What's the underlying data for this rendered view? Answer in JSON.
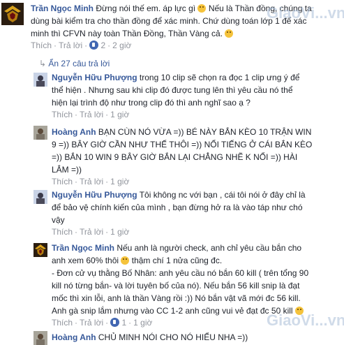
{
  "comment1": {
    "author": "Trần Ngọc Minh",
    "line1": " Đừng nói thế em. áp lực gì ",
    "line1b": " Nếu là Thần đồng, chúng ta",
    "line2": "dùng bài kiểm tra cho thần đồng để xác minh. Chứ dùng toán lớp 1 để xác",
    "line3": "minh thì CFVN này toàn Thần Đồng, Thần Vàng cả. ",
    "like_label": "Thích",
    "reply_label": "Trả lời",
    "like_count": "2",
    "time": "2 giờ"
  },
  "hide_replies": {
    "label": "Ẩn 27 câu trả lời"
  },
  "reply1": {
    "author": "Nguyễn Hữu Phượng",
    "line1": " trong 10 clip sẽ chọn ra đọc 1 clip ưng ý để",
    "line2": "thể hiện . Nhưng sau khi clip đó được tung lên thì yêu cầu nó thể",
    "line3": "hiện lại trình độ như trong clip đó thì anh nghĩ sao ạ ?",
    "like_label": "Thích",
    "reply_label": "Trả lời",
    "time": "1 giờ"
  },
  "reply2": {
    "author": "Hoàng Anh",
    "line1": " BẠN CÙN NÓ VỪA =)) BÉ NÀY BẮN KÈO 10 TRẬN WIN",
    "line2": "9 =)) BÂY GIỜ CẦN NHƯ THẾ THÔI =)) NỔI TIẾNG Ở CÁI BẮN KÈO",
    "line3": "=)) BẮN 10 WIN 9 BÂY GIỜ BẮN LẠI CHẲNG NHẼ K NỔI =)) HÀI",
    "line4": "LẮM =))",
    "like_label": "Thích",
    "reply_label": "Trả lời",
    "time": "1 giờ"
  },
  "reply3": {
    "author": "Nguyễn Hữu Phượng",
    "line1": " Tôi không nc với bạn , cái tôi nói ở đây chỉ là",
    "line2": "để bảo vệ chính kiến của mình , bạn đừng hở ra là vào táp như chó",
    "line3": "vậy",
    "like_label": "Thích",
    "reply_label": "Trả lời",
    "time": "1 giờ"
  },
  "reply4": {
    "author": "Trần Ngọc Minh",
    "line1": " Nếu anh là người check, anh chỉ yêu cầu bắn cho",
    "line2": "anh xem 60% thôi ",
    "line2b": " thậm chí 1 nửa cũng đc.",
    "line3": "- Đơn cử vụ thằng Bố Nhân: anh yêu cầu nó bắn 60 kill ( trên tổng 90",
    "line4": "kill nó từng bắn- và lời tuyên bố của nó). Nếu bắn 56 kill snip là đạt",
    "line5": "mốc thì xin lỗi, anh là thần Vàng rồi :)) Nó bắn vật vã mới đc 56 kill.",
    "line6": "Anh gà snip lắm nhưng vào CC 1-2 anh cũng vui vẻ đạt đc 50 kill ",
    "like_label": "Thích",
    "reply_label": "Trả lời",
    "like_count": "1",
    "time": "1 giờ"
  },
  "reply5": {
    "author": "Hoàng Anh",
    "text": " CHỦ MINH NÓI CHO NÓ HIỂU NHA =))"
  },
  "watermark": {
    "text": "GiaoVi...vn"
  },
  "colors": {
    "name_blue": "#365899",
    "meta_gray": "#90949c",
    "text": "#1d2129"
  }
}
